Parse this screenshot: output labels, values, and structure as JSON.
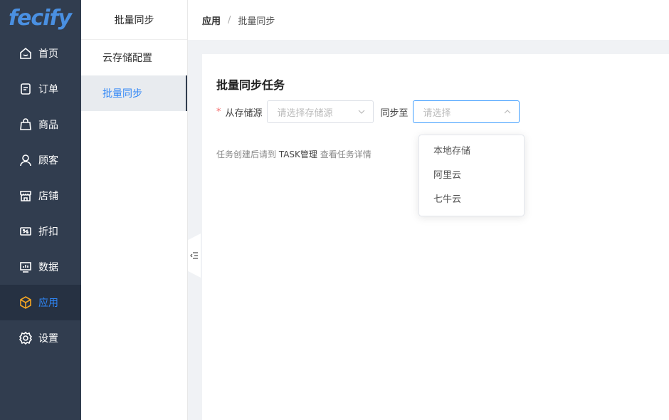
{
  "logo": {
    "text": "fecify",
    "brand_color": "#4a90e2",
    "accent_color": "#f5a623"
  },
  "nav": [
    {
      "label": "首页",
      "icon": "home-icon",
      "active": false
    },
    {
      "label": "订单",
      "icon": "order-icon",
      "active": false
    },
    {
      "label": "商品",
      "icon": "bag-icon",
      "active": false
    },
    {
      "label": "顾客",
      "icon": "user-icon",
      "active": false
    },
    {
      "label": "店铺",
      "icon": "store-icon",
      "active": false
    },
    {
      "label": "折扣",
      "icon": "discount-icon",
      "active": false
    },
    {
      "label": "数据",
      "icon": "chart-icon",
      "active": false
    },
    {
      "label": "应用",
      "icon": "box-icon",
      "active": true
    },
    {
      "label": "设置",
      "icon": "gear-icon",
      "active": false
    }
  ],
  "submenu": {
    "title": "批量同步",
    "items": [
      {
        "label": "云存储配置",
        "active": false
      },
      {
        "label": "批量同步",
        "active": true
      }
    ]
  },
  "breadcrumb": {
    "parent": "应用",
    "separator": "/",
    "current": "批量同步"
  },
  "card": {
    "title": "批量同步任务",
    "required_mark": "*",
    "source_label": "从存储源",
    "source_placeholder": "请选择存储源",
    "target_label": "同步至",
    "target_placeholder": "请选择",
    "hint_prefix": "任务创建后请到 ",
    "hint_link": "TASK管理",
    "hint_suffix": " 查看任务详情"
  },
  "dropdown": {
    "options": [
      "本地存储",
      "阿里云",
      "七牛云"
    ]
  },
  "colors": {
    "sidebar_bg": "#313d4f",
    "active_blue": "#2f86f6",
    "required_red": "#f56c6c"
  }
}
